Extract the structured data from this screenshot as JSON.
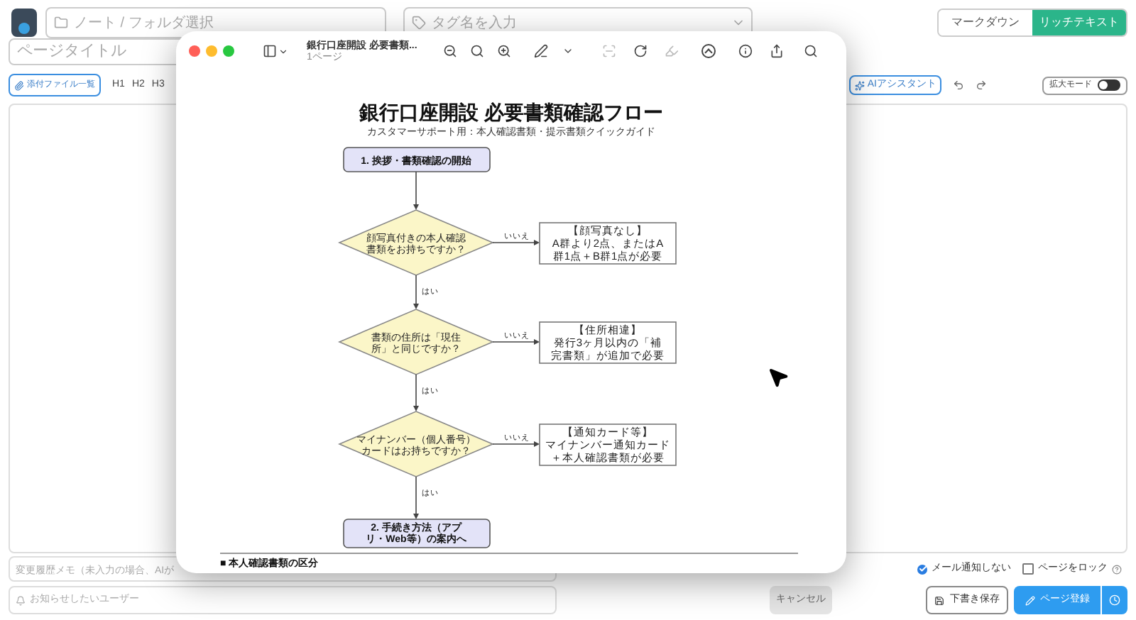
{
  "header": {
    "note_field": {
      "placeholder": "ノート / フォルダ選択"
    },
    "tag_field": {
      "placeholder": "タグ名を入力"
    },
    "mode_tabs": [
      {
        "label": "マークダウン",
        "selected": false
      },
      {
        "label": "リッチテキスト",
        "selected": true
      }
    ]
  },
  "page_title": {
    "placeholder": "ページタイトル"
  },
  "editor_toolbar": {
    "attachments_button": "添付ファイル一覧",
    "headings": [
      "H1",
      "H2",
      "H3"
    ],
    "ai_button": "AIアシスタント",
    "zoom_mode": {
      "label": "拡大モード",
      "on": false
    }
  },
  "preview_window": {
    "title": "銀行口座開設 必要書類...",
    "subtitle": "1ページ",
    "document": {
      "title": "銀行口座開設 必要書類確認フロー",
      "subtitle": "カスタマーサポート用：本人確認書類・提示書類クイックガイド",
      "start": "1. 挨拶・書類確認の開始",
      "decisions": [
        {
          "question": [
            "顔写真付きの本人確認",
            "書類をお持ちですか？"
          ],
          "no_label": "いいえ",
          "yes_label": "はい",
          "result": [
            "【顔写真なし】",
            "A群より2点、またはA",
            "群1点＋B群1点が必要"
          ]
        },
        {
          "question": [
            "書類の住所は「現住",
            "所」と同じですか？"
          ],
          "no_label": "いいえ",
          "yes_label": "はい",
          "result": [
            "【住所相違】",
            "発行3ヶ月以内の「補",
            "完書類」が追加で必要"
          ]
        },
        {
          "question": [
            "マイナンバー（個人番号）",
            "カードはお持ちですか？"
          ],
          "no_label": "いいえ",
          "yes_label": "はい",
          "result": [
            "【通知カード等】",
            "マイナンバー通知カード",
            "＋本人確認書類が必要"
          ]
        }
      ],
      "end": [
        "2. 手続き方法（アプ",
        "リ・Web等）の案内へ"
      ],
      "section_heading": "■ 本人確認書類の区分"
    }
  },
  "footer": {
    "memo_field": {
      "placeholder": "変更履歴メモ（未入力の場合、AIが"
    },
    "notify_field": {
      "placeholder": "お知らせしたいユーザー"
    },
    "mail_notify": {
      "label": "メール通知しない",
      "checked": true
    },
    "lock_page": {
      "label": "ページをロック",
      "checked": false
    },
    "cancel_button": "キャンセル",
    "draft_button": "下書き保存",
    "publish_button": "ページ登録"
  }
}
